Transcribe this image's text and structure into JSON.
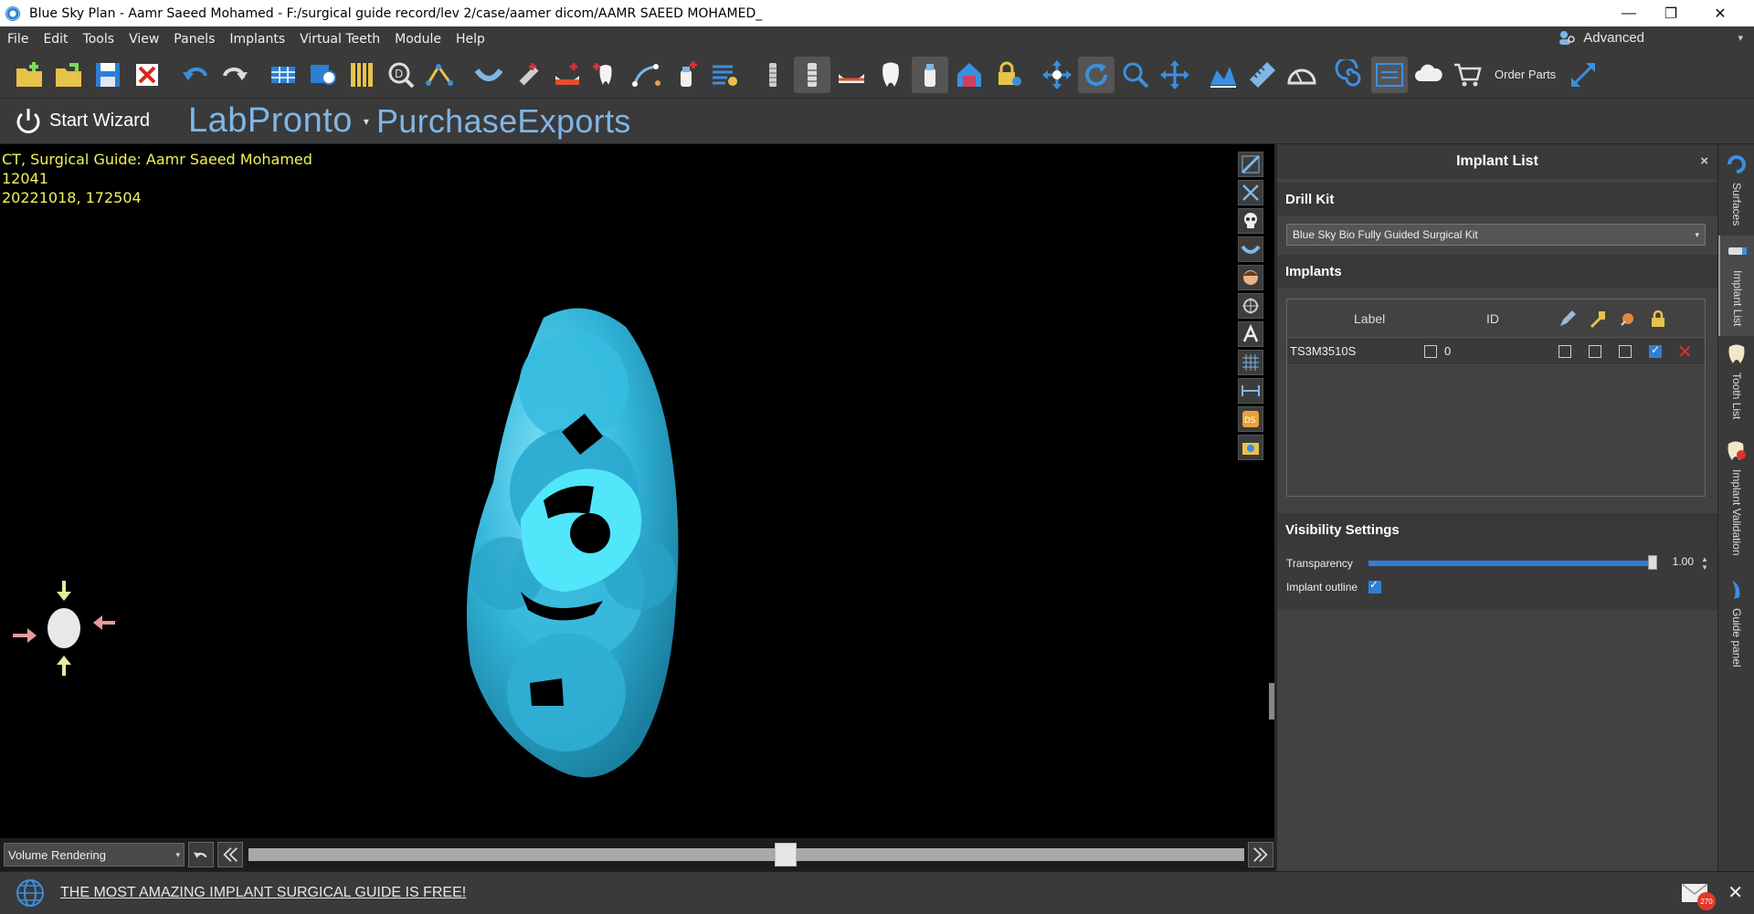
{
  "window": {
    "title": "Blue Sky Plan - Aamr Saeed Mohamed - F:/surgical guide record/lev 2/case/aamer dicom/AAMR SAEED MOHAMED_",
    "minimize": "—",
    "maximize": "❐",
    "close": "✕"
  },
  "menu": {
    "items": [
      "File",
      "Edit",
      "Tools",
      "View",
      "Panels",
      "Implants",
      "Virtual Teeth",
      "Module",
      "Help"
    ],
    "mode_label": "Advanced",
    "mode_dropdown": "▾"
  },
  "toolbar": {
    "order_parts_label": "Order Parts"
  },
  "bar2": {
    "start_wizard": "Start Wizard",
    "labpronto": "LabPronto",
    "labpronto_dropdown": "▾",
    "purchase_exports": "PurchaseExports"
  },
  "viewport": {
    "info_line1": "CT, Surgical Guide: Aamr Saeed Mohamed",
    "info_line2": "12041",
    "info_line3": "20221018, 172504",
    "render_mode": "Volume Rendering",
    "render_mode_arrow": "▾",
    "slice_position": 0.54,
    "model_color": "#3bb4d8"
  },
  "panel": {
    "title": "Implant List",
    "close": "×",
    "drill_kit_heading": "Drill Kit",
    "drill_kit_value": "Blue Sky Bio Fully Guided Surgical Kit",
    "implants_heading": "Implants",
    "table": {
      "col_label": "Label",
      "col_id": "ID",
      "rows": [
        {
          "label": "TS3M3510S",
          "id": "0",
          "locked": true
        }
      ]
    },
    "visibility_heading": "Visibility Settings",
    "transparency_label": "Transparency",
    "transparency_value": "1.00",
    "implant_outline_label": "Implant outline",
    "implant_outline_checked": true
  },
  "sidetabs": {
    "surfaces": "Surfaces",
    "implant_list": "Implant List",
    "tooth_list": "Tooth List",
    "implant_validation": "Implant Validation",
    "guide_panel": "Guide panel"
  },
  "status": {
    "promo": "THE MOST AMAZING IMPLANT SURGICAL GUIDE IS FREE!",
    "mail_count": "270",
    "close": "✕"
  },
  "colors": {
    "accent": "#2f7fd6",
    "brand_blue": "#7fb6e6",
    "info_yellow": "#f2f25a",
    "model_cyan": "#3bb4d8"
  }
}
